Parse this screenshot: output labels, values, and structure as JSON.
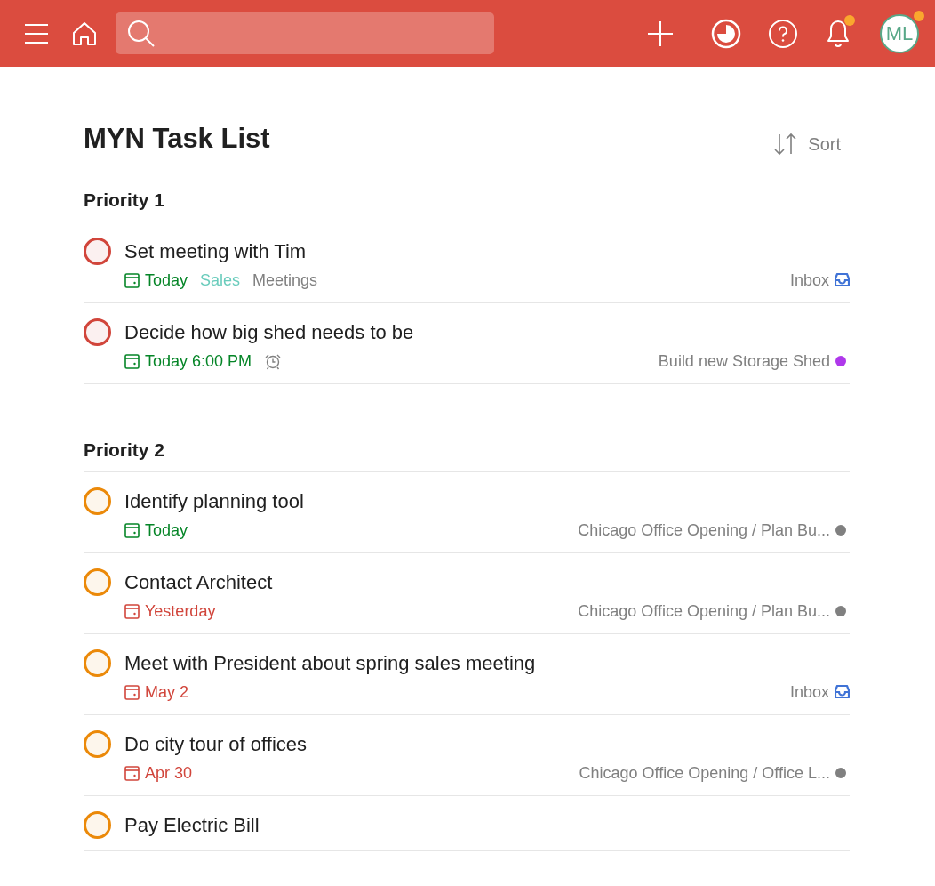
{
  "header": {
    "avatar": {
      "initials": "ML",
      "badge": true
    },
    "notifications": {
      "badge": true
    }
  },
  "page": {
    "title": "MYN Task List",
    "sort_label": "Sort"
  },
  "sections": [
    {
      "title": "Priority 1",
      "tasks": [
        {
          "title": "Set meeting with Tim",
          "color": "#d1453b",
          "due": {
            "text": "Today",
            "overdue": false
          },
          "labels": [
            {
              "text": "Sales",
              "color": "#6accbc"
            },
            {
              "text": "Meetings",
              "color": "#808080"
            }
          ],
          "project": {
            "text": "Inbox",
            "kind": "inbox",
            "color": "#4073d6"
          }
        },
        {
          "title": "Decide how big shed needs to be",
          "color": "#d1453b",
          "due": {
            "text": "Today 6:00 PM",
            "overdue": false
          },
          "reminder": true,
          "project": {
            "text": "Build new Storage Shed",
            "kind": "dot",
            "color": "#af38eb"
          }
        }
      ]
    },
    {
      "title": "Priority 2",
      "tasks": [
        {
          "title": "Identify planning tool",
          "color": "#eb8909",
          "due": {
            "text": "Today",
            "overdue": false
          },
          "project": {
            "text": "Chicago Office Opening / Plan Bu...",
            "kind": "dot",
            "color": "#808080"
          }
        },
        {
          "title": "Contact Architect",
          "color": "#eb8909",
          "due": {
            "text": "Yesterday",
            "overdue": true
          },
          "project": {
            "text": "Chicago Office Opening / Plan Bu...",
            "kind": "dot",
            "color": "#808080"
          }
        },
        {
          "title": "Meet with President about spring sales meeting",
          "color": "#eb8909",
          "due": {
            "text": "May 2",
            "overdue": true
          },
          "project": {
            "text": "Inbox",
            "kind": "inbox",
            "color": "#4073d6"
          }
        },
        {
          "title": "Do city tour of offices",
          "color": "#eb8909",
          "due": {
            "text": "Apr 30",
            "overdue": true
          },
          "project": {
            "text": "Chicago Office Opening / Office L...",
            "kind": "dot",
            "color": "#808080"
          }
        },
        {
          "title": "Pay Electric Bill",
          "color": "#eb8909"
        }
      ]
    }
  ]
}
